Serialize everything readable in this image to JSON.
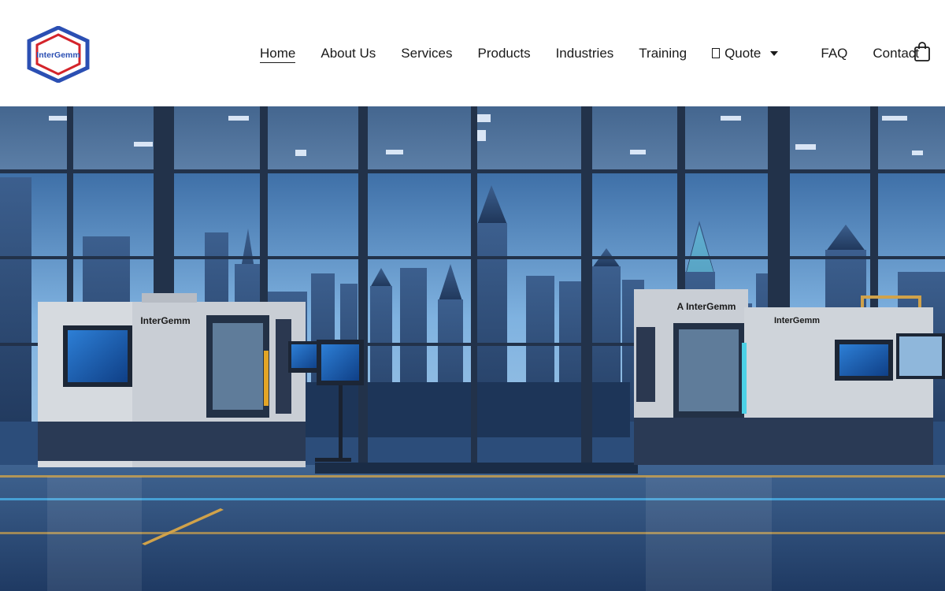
{
  "brand": {
    "logo_text": "InterGemm",
    "colors": {
      "blue": "#2b4fb3",
      "red": "#d4242b"
    }
  },
  "nav": {
    "items": [
      {
        "label": "Home",
        "active": true
      },
      {
        "label": "About Us"
      },
      {
        "label": "Services"
      },
      {
        "label": "Products"
      },
      {
        "label": "Industries"
      },
      {
        "label": "Training"
      }
    ],
    "quote": {
      "label": "Quote",
      "icon": "quote-icon",
      "dropdown_icon": "chevron-down-icon"
    },
    "faq": "FAQ",
    "contact": "Contact",
    "cart_icon": "shopping-bag-icon"
  },
  "hero": {
    "machine_left_label": "InterGemm",
    "machine_right_label": "InterGemm",
    "machine_right_brand": "A InterGemm",
    "colors": {
      "sky": "#7fb2e0",
      "floor": "#2b4a78",
      "accent_line": "#d0a24a"
    }
  }
}
